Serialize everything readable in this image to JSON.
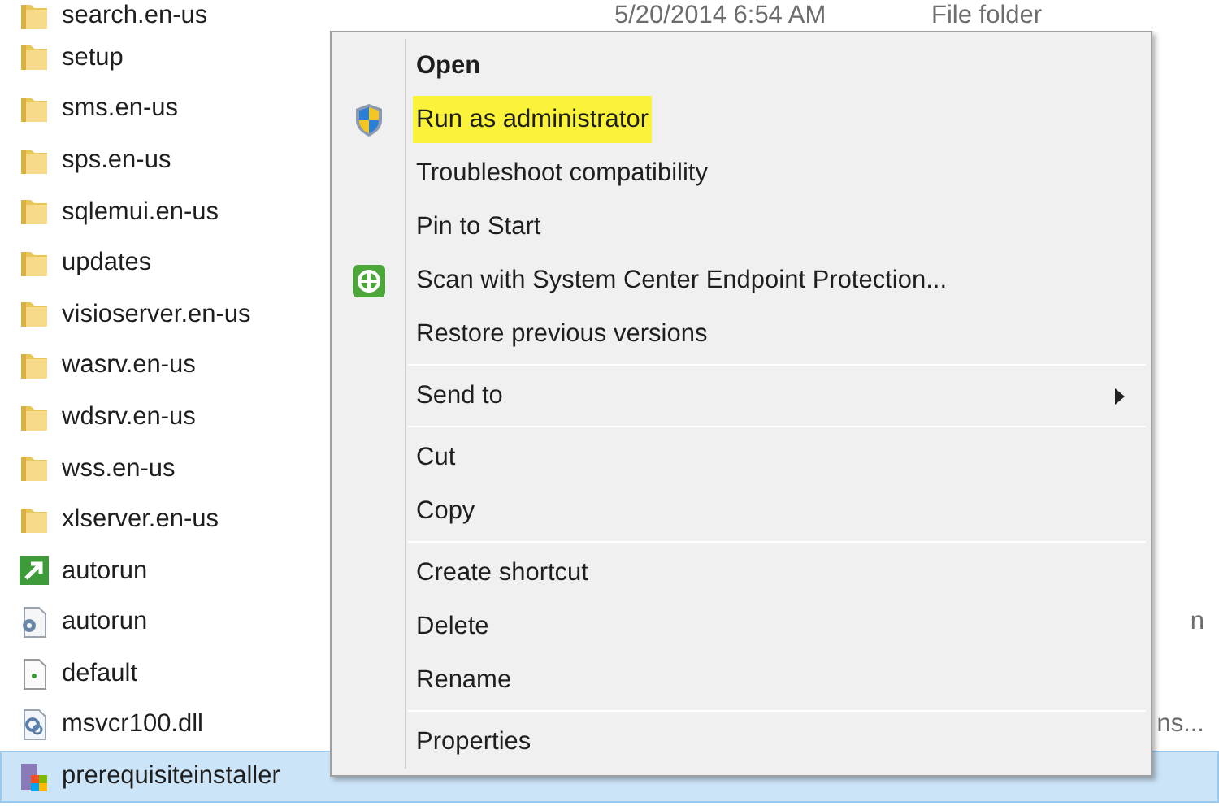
{
  "files": [
    {
      "name": "search.en-us",
      "kind": "folder",
      "selected": false,
      "date": "5/20/2014 6:54 AM",
      "type": "File folder"
    },
    {
      "name": "setup",
      "kind": "folder",
      "selected": false
    },
    {
      "name": "sms.en-us",
      "kind": "folder",
      "selected": false
    },
    {
      "name": "sps.en-us",
      "kind": "folder",
      "selected": false
    },
    {
      "name": "sqlemui.en-us",
      "kind": "folder",
      "selected": false
    },
    {
      "name": "updates",
      "kind": "folder",
      "selected": false
    },
    {
      "name": "visioserver.en-us",
      "kind": "folder",
      "selected": false
    },
    {
      "name": "wasrv.en-us",
      "kind": "folder",
      "selected": false
    },
    {
      "name": "wdsrv.en-us",
      "kind": "folder",
      "selected": false
    },
    {
      "name": "wss.en-us",
      "kind": "folder",
      "selected": false
    },
    {
      "name": "xlserver.en-us",
      "kind": "folder",
      "selected": false
    },
    {
      "name": "autorun",
      "kind": "shortcut",
      "selected": false
    },
    {
      "name": "autorun",
      "kind": "settings",
      "selected": false,
      "type": "n"
    },
    {
      "name": "default",
      "kind": "page",
      "selected": false
    },
    {
      "name": "msvcr100.dll",
      "kind": "dll",
      "selected": false,
      "type": "ns..."
    },
    {
      "name": "prerequisiteinstaller",
      "kind": "installer",
      "selected": true
    }
  ],
  "context_menu": [
    {
      "kind": "plain",
      "label": "Open",
      "default": true,
      "highlighted": false
    },
    {
      "kind": "shield",
      "label": "Run as administrator",
      "default": false,
      "highlighted": true
    },
    {
      "kind": "plain",
      "label": "Troubleshoot compatibility",
      "default": false,
      "highlighted": false
    },
    {
      "kind": "plain",
      "label": "Pin to Start",
      "default": false,
      "highlighted": false
    },
    {
      "kind": "scan",
      "label": "Scan with System Center Endpoint Protection...",
      "default": false,
      "highlighted": false
    },
    {
      "kind": "plain",
      "label": "Restore previous versions",
      "default": false,
      "highlighted": false
    },
    {
      "kind": "separator"
    },
    {
      "kind": "submenu",
      "label": "Send to",
      "default": false,
      "highlighted": false
    },
    {
      "kind": "separator"
    },
    {
      "kind": "plain",
      "label": "Cut",
      "default": false,
      "highlighted": false
    },
    {
      "kind": "plain",
      "label": "Copy",
      "default": false,
      "highlighted": false
    },
    {
      "kind": "separator"
    },
    {
      "kind": "plain",
      "label": "Create shortcut",
      "default": false,
      "highlighted": false
    },
    {
      "kind": "plain",
      "label": "Delete",
      "default": false,
      "highlighted": false
    },
    {
      "kind": "plain",
      "label": "Rename",
      "default": false,
      "highlighted": false
    },
    {
      "kind": "separator"
    },
    {
      "kind": "plain",
      "label": "Properties",
      "default": false,
      "highlighted": false
    }
  ]
}
